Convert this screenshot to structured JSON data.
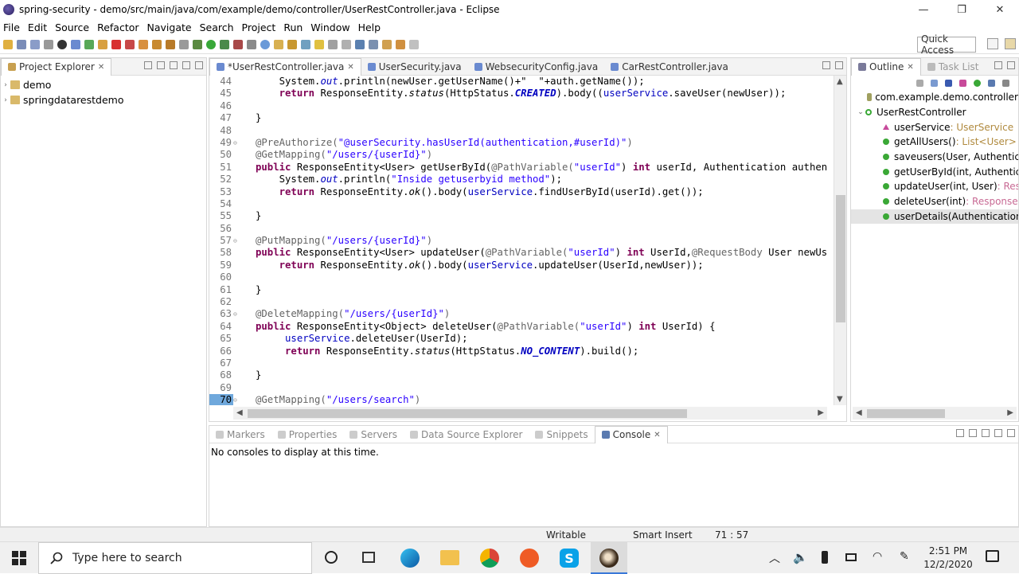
{
  "window": {
    "title": "spring-security - demo/src/main/java/com/example/demo/controller/UserRestController.java - Eclipse",
    "minimize": "—",
    "maximize": "❐",
    "close": "✕"
  },
  "menu": [
    "File",
    "Edit",
    "Source",
    "Refactor",
    "Navigate",
    "Search",
    "Project",
    "Run",
    "Window",
    "Help"
  ],
  "quick_access": "Quick Access",
  "project_explorer": {
    "tab_label": "Project Explorer",
    "items": [
      "demo",
      "springdatarestdemo"
    ]
  },
  "editor": {
    "tabs": [
      {
        "label": "*UserRestController.java",
        "active": true
      },
      {
        "label": "UserSecurity.java",
        "active": false
      },
      {
        "label": "WebsecurityConfig.java",
        "active": false
      },
      {
        "label": "CarRestController.java",
        "active": false
      }
    ],
    "lines": [
      {
        "n": "44",
        "fold": ""
      },
      {
        "n": "45",
        "fold": ""
      },
      {
        "n": "46",
        "fold": ""
      },
      {
        "n": "47",
        "fold": ""
      },
      {
        "n": "48",
        "fold": ""
      },
      {
        "n": "49",
        "fold": "⊖"
      },
      {
        "n": "50",
        "fold": ""
      },
      {
        "n": "51",
        "fold": ""
      },
      {
        "n": "52",
        "fold": ""
      },
      {
        "n": "53",
        "fold": ""
      },
      {
        "n": "54",
        "fold": ""
      },
      {
        "n": "55",
        "fold": ""
      },
      {
        "n": "56",
        "fold": ""
      },
      {
        "n": "57",
        "fold": "⊖"
      },
      {
        "n": "58",
        "fold": ""
      },
      {
        "n": "59",
        "fold": ""
      },
      {
        "n": "60",
        "fold": ""
      },
      {
        "n": "61",
        "fold": ""
      },
      {
        "n": "62",
        "fold": ""
      },
      {
        "n": "63",
        "fold": "⊖"
      },
      {
        "n": "64",
        "fold": ""
      },
      {
        "n": "65",
        "fold": ""
      },
      {
        "n": "66",
        "fold": ""
      },
      {
        "n": "67",
        "fold": ""
      },
      {
        "n": "68",
        "fold": ""
      },
      {
        "n": "69",
        "fold": ""
      },
      {
        "n": "70",
        "fold": "⊖"
      }
    ],
    "code": {
      "l44a": "    System.",
      "l44b": "out",
      "l44c": ".println(newUser.getUserName()+\"  \"+auth.getName());",
      "l45a": "    ",
      "l45kw": "return",
      "l45b": " ResponseEntity.",
      "l45c": "status",
      "l45d": "(HttpStatus.",
      "l45e": "CREATED",
      "l45f": ").body((",
      "l45g": "userService",
      "l45h": ".saveUser(newUser));",
      "l47": "}",
      "l49a": "@PreAuthorize(",
      "l49b": "\"@userSecurity.hasUserId(authentication,#userId)\"",
      "l49c": ")",
      "l50a": "@GetMapping(",
      "l50b": "\"/users/{userId}\"",
      "l50c": ")",
      "l51kw": "public",
      "l51a": " ResponseEntity<User> getUserById(",
      "l51b": "@PathVariable(",
      "l51c": "\"userId\"",
      "l51d": ") ",
      "l51kw2": "int",
      "l51e": " userId, Authentication authen",
      "l52a": "    System.",
      "l52b": "out",
      "l52c": ".println(",
      "l52d": "\"Inside getuserbyid method\"",
      "l52e": ");",
      "l53a": "    ",
      "l53kw": "return",
      "l53b": " ResponseEntity.",
      "l53c": "ok",
      "l53d": "().body(",
      "l53e": "userService",
      "l53f": ".findUserById(userId).get());",
      "l55": "}",
      "l57a": "@PutMapping(",
      "l57b": "\"/users/{userId}\"",
      "l57c": ")",
      "l58kw": "public",
      "l58a": " ResponseEntity<User> updateUser(",
      "l58b": "@PathVariable(",
      "l58c": "\"userId\"",
      "l58d": ") ",
      "l58kw2": "int",
      "l58e": " UserId,",
      "l58f": "@RequestBody",
      "l58g": " User newUs",
      "l59a": "    ",
      "l59kw": "return",
      "l59b": " ResponseEntity.",
      "l59c": "ok",
      "l59d": "().body(",
      "l59e": "userService",
      "l59f": ".updateUser(UserId,newUser));",
      "l61": "}",
      "l63a": "@DeleteMapping(",
      "l63b": "\"/users/{userId}\"",
      "l63c": ")",
      "l64kw": "public",
      "l64a": " ResponseEntity<Object> deleteUser(",
      "l64b": "@PathVariable(",
      "l64c": "\"userId\"",
      "l64d": ") ",
      "l64kw2": "int",
      "l64e": " UserId) {",
      "l65a": "     ",
      "l65b": "userService",
      "l65c": ".deleteUser(UserId);",
      "l66a": "     ",
      "l66kw": "return",
      "l66b": " ResponseEntity.",
      "l66c": "status",
      "l66d": "(HttpStatus.",
      "l66e": "NO_CONTENT",
      "l66f": ").build();",
      "l68": "}",
      "l70a": "@GetMapping(",
      "l70b": "\"/users/search\"",
      "l70c": ")"
    }
  },
  "outline": {
    "tab_label": "Outline",
    "tab2_label": "Task List",
    "package": "com.example.demo.controller",
    "class": "UserRestController",
    "members": [
      {
        "name": "userService",
        "type": " : UserService",
        "kind": "field"
      },
      {
        "name": "getAllUsers()",
        "type": " : List<User>",
        "kind": "method"
      },
      {
        "name": "saveusers(User, Authenticatio",
        "type": "",
        "kind": "method"
      },
      {
        "name": "getUserById(int, Authenticatic",
        "type": "",
        "kind": "method"
      },
      {
        "name": "updateUser(int, User)",
        "type": " : Respor",
        "kind": "method"
      },
      {
        "name": "deleteUser(int)",
        "type": " : ResponseEnti",
        "kind": "method"
      },
      {
        "name": "userDetails(Authentication, St",
        "type": "",
        "kind": "method",
        "selected": true
      }
    ]
  },
  "bottom": {
    "tabs": [
      "Markers",
      "Properties",
      "Servers",
      "Data Source Explorer",
      "Snippets",
      "Console"
    ],
    "active_tab": "Console",
    "message": "No consoles to display at this time."
  },
  "status": {
    "writable": "Writable",
    "insert_mode": "Smart Insert",
    "position": "71 : 57"
  },
  "taskbar": {
    "search_placeholder": "Type here to search",
    "time": "2:51 PM",
    "date": "12/2/2020"
  },
  "colors": {
    "keyword": "#7f0055",
    "string": "#2a00ff",
    "annotation": "#646464",
    "field": "#0000c0"
  }
}
